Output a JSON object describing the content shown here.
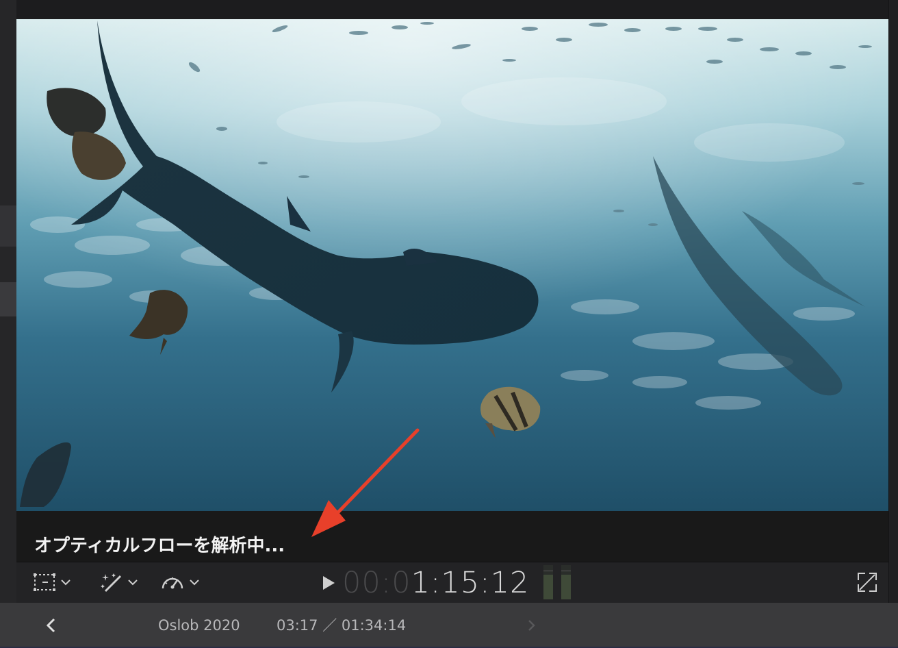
{
  "viewer": {
    "status_text": "オプティカルフローを解析中..."
  },
  "controls": {
    "transform_icon": "crop-transform-icon",
    "enhance_icon": "magic-wand-icon",
    "retime_icon": "speedometer-icon",
    "playback": {
      "play_icon": "play-icon",
      "timecode_dim": "00:0",
      "timecode_lit": "1:15:12"
    },
    "fullscreen_icon": "fullscreen-icon"
  },
  "nav": {
    "project_name": "Oslob 2020",
    "time_display": "03:17 ／ 01:34:14"
  },
  "colors": {
    "annotation_arrow": "#e8402a",
    "water_light": "#cfe6ea",
    "water_deep": "#1f4f68"
  }
}
